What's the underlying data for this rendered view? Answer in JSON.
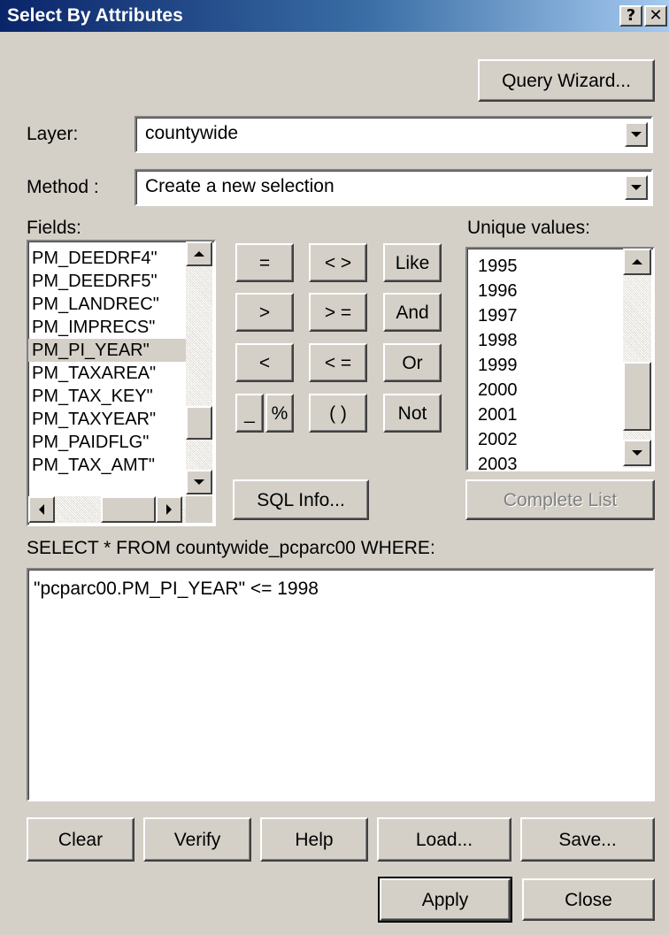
{
  "dialog": {
    "title": "Select By Attributes",
    "help_icon": "?",
    "close_icon": "✕"
  },
  "query_wizard_label": "Query Wizard...",
  "layer": {
    "label": "Layer:",
    "value": "countywide"
  },
  "method": {
    "label": "Method :",
    "value": "Create a new selection"
  },
  "fields": {
    "label": "Fields:",
    "items": [
      "PM_DEEDRF4\"",
      "PM_DEEDRF5\"",
      "PM_LANDREC\"",
      "PM_IMPRECS\"",
      "PM_PI_YEAR\"",
      "PM_TAXAREA\"",
      "PM_TAX_KEY\"",
      "PM_TAXYEAR\"",
      "PM_PAIDFLG\"",
      "PM_TAX_AMT\""
    ],
    "selected_index": 4
  },
  "operators": {
    "eq": "=",
    "neq": "< >",
    "like": "Like",
    "gt": ">",
    "gte": "> =",
    "and": "And",
    "lt": "<",
    "lte": "< =",
    "or": "Or",
    "underscore": "_",
    "percent": "%",
    "parens": "( )",
    "not": "Not"
  },
  "sql_info_label": "SQL Info...",
  "unique_values": {
    "label": "Unique values:",
    "items": [
      "1995",
      "1996",
      "1997",
      "1998",
      "1999",
      "2000",
      "2001",
      "2002",
      "2003"
    ]
  },
  "complete_list_label": "Complete List",
  "select_statement": "SELECT * FROM countywide_pcparc00 WHERE:",
  "expression": "\"pcparc00.PM_PI_YEAR\" <= 1998",
  "buttons": {
    "clear": "Clear",
    "verify": "Verify",
    "help": "Help",
    "load": "Load...",
    "save": "Save...",
    "apply": "Apply",
    "close": "Close"
  },
  "colors": {
    "dialog_bg": "#d4d0c8",
    "title_start": "#0a246a",
    "title_end": "#a6caf0"
  }
}
